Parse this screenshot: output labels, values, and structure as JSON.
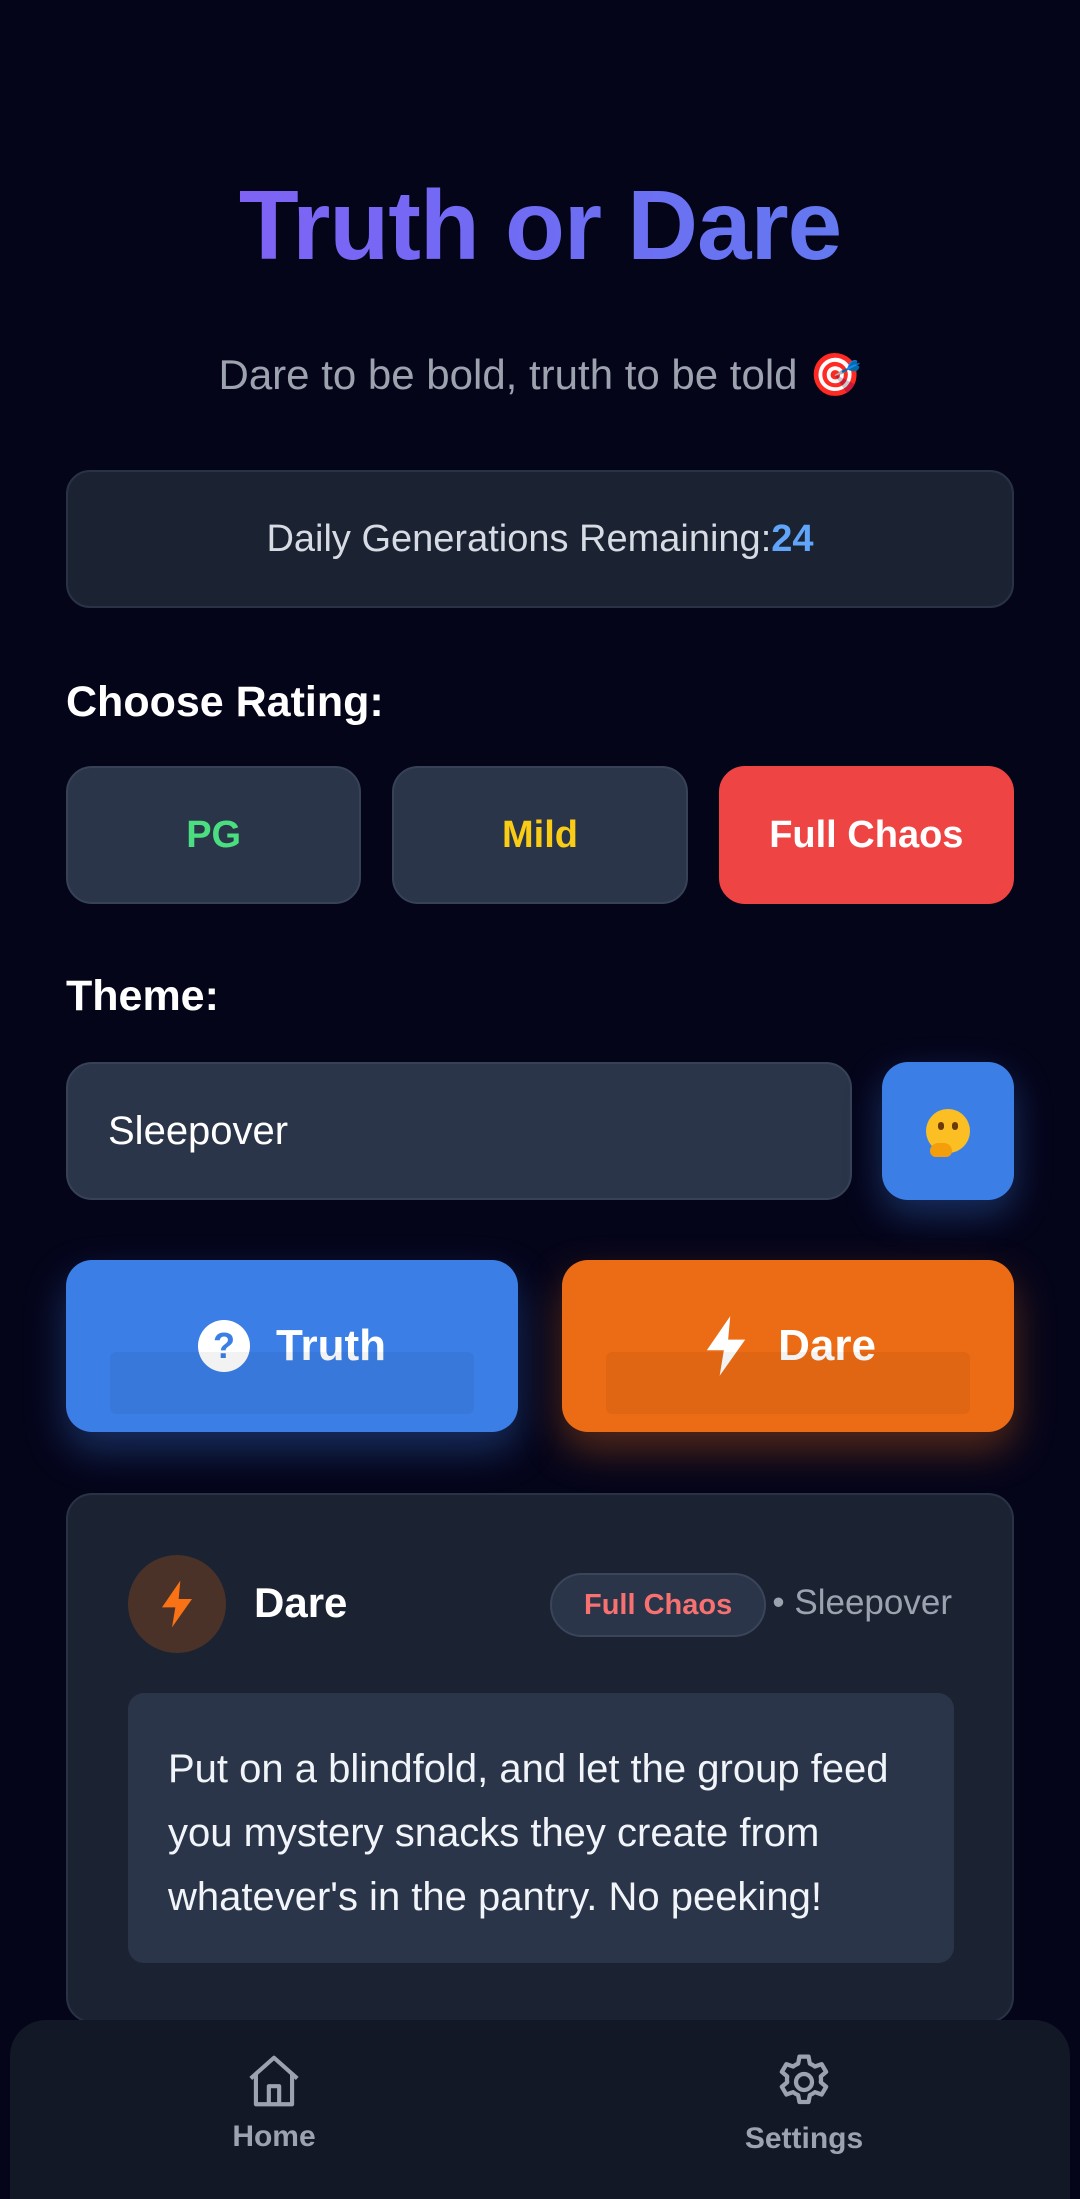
{
  "header": {
    "title": "Truth or Dare",
    "subtitle": "Dare to be bold, truth to be told",
    "subtitle_emoji": "🎯"
  },
  "generations": {
    "label": "Daily Generations Remaining:",
    "count": "24"
  },
  "rating": {
    "label": "Choose Rating:",
    "options": [
      "PG",
      "Mild",
      "Full Chaos"
    ],
    "selected": "Full Chaos"
  },
  "theme": {
    "label": "Theme:",
    "value": "Sleepover",
    "random_icon": "thinking-face-icon"
  },
  "actions": {
    "truth_label": "Truth",
    "dare_label": "Dare"
  },
  "result": {
    "type": "Dare",
    "rating_badge": "Full Chaos",
    "theme_text": "• Sleepover",
    "text": "Put on a blindfold, and let the group feed you mystery snacks they create from whatever's in the pantry. No peeking!"
  },
  "nav": {
    "home_label": "Home",
    "settings_label": "Settings"
  },
  "colors": {
    "background": "#05051a",
    "truth": "#3b7fe6",
    "dare": "#ec6c16",
    "chaos": "#ef4444",
    "pg": "#4ade80",
    "mild": "#facc15",
    "accent": "#60a5fa"
  }
}
